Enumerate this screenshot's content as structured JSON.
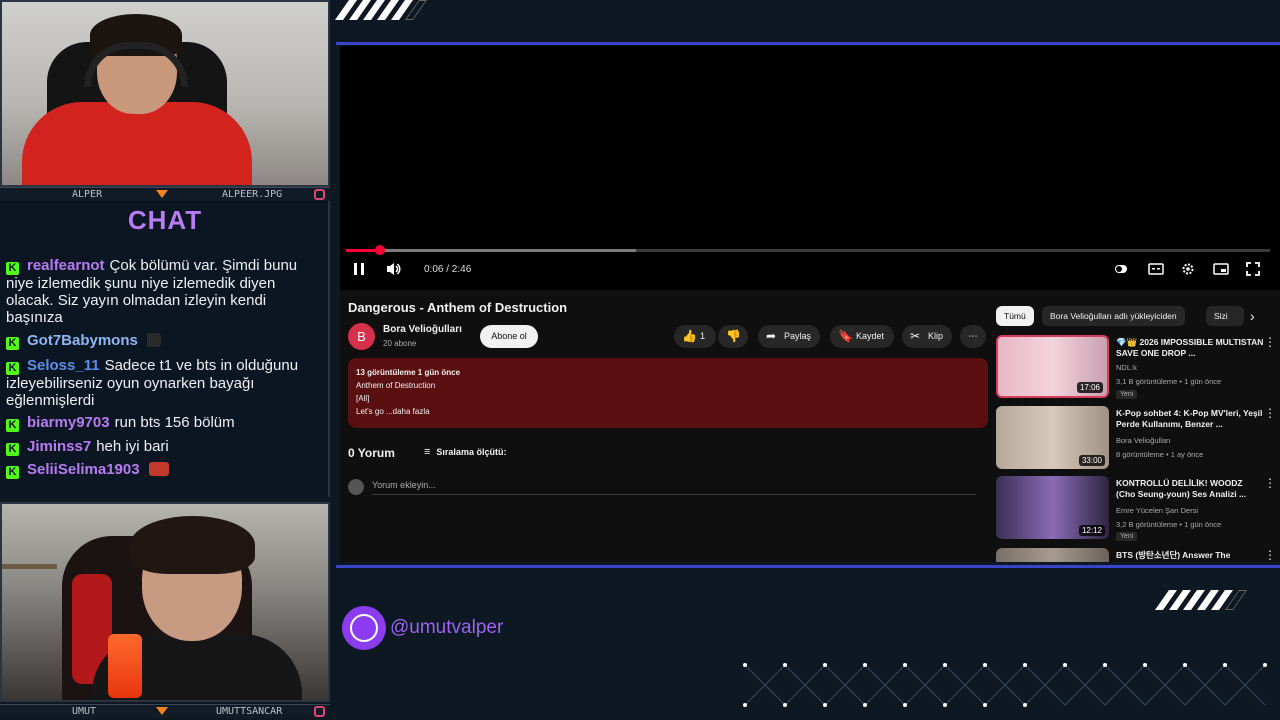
{
  "cams": {
    "top": {
      "left_name": "ALPER",
      "right_name": "ALPEER.JPG"
    },
    "bottom": {
      "left_name": "UMUT",
      "right_name": "UMUTTSANCAR"
    }
  },
  "chat": {
    "title": "CHAT",
    "messages": [
      {
        "user": "realfearnot",
        "color": "#b77cf2",
        "text": "Çok bölümü var. Şimdi bunu niye izlemedik şunu niye izlemedik diyen olacak. Siz yayın olmadan izleyin kendi başınıza"
      },
      {
        "user": "Got7Babymons",
        "color": "#8db6f2",
        "text": ""
      },
      {
        "user": "Seloss_11",
        "color": "#5b8ee8",
        "text": "Sadece t1 ve bts in olduğunu izleyebilirseniz oyun oynarken bayağı eğlenmişlerdi"
      },
      {
        "user": "biarmy9703",
        "color": "#b77cf2",
        "text": "run bts 156 bölüm"
      },
      {
        "user": "Jiminss7",
        "color": "#b77cf2",
        "text": "heh iyi bari"
      },
      {
        "user": "SeliiSelima1903",
        "color": "#b77cf2",
        "text": ""
      }
    ]
  },
  "player": {
    "time": "0:06 / 2:46",
    "progress_fraction": 0.037,
    "buffer_fraction": 0.314
  },
  "video": {
    "title": "Dangerous - Anthem of Destruction",
    "channel": "Bora Velioğulları",
    "subs": "20 abone",
    "subscribe": "Abone ol",
    "likes": "1",
    "share": "Paylaş",
    "save": "Kaydet",
    "clip": "Klip",
    "desc": {
      "stats": "13 görüntüleme  1 gün önce",
      "line1": "Anthem of Destruction",
      "line2": "[All]",
      "line3": "Let's go ...daha fazla"
    },
    "comments": "0 Yorum",
    "sort": "Sıralama ölçütü:",
    "comment_placeholder": "Yorum ekleyin..."
  },
  "chips": [
    "Tümü",
    "Bora Velioğulları adlı yükleyiciden",
    "Sizi"
  ],
  "recs": [
    {
      "title": "💎👑 2026 IMPOSSIBLE MULTISTAN SAVE ONE DROP ...",
      "channel": "NDL:k",
      "meta": "3,1 B görüntüleme • 1 gün önce",
      "badge": "Yeni",
      "duration": "17:06"
    },
    {
      "title": "K-Pop sohbet 4: K-Pop MV'leri, Yeşil Perde Kullanımı, Benzer ...",
      "channel": "Bora Velioğulları",
      "meta": "8 görüntüleme • 1 ay önce",
      "badge": "",
      "duration": "33:00"
    },
    {
      "title": "KONTROLLÜ DELİLİK! WOODZ (Cho Seung-youn) Ses Analizi ...",
      "channel": "Emre Yücelen Şan Dersi",
      "meta": "3,2 B görüntüleme • 1 gün önce",
      "badge": "Yeni",
      "duration": "12:12"
    },
    {
      "title": "BTS (방탄소년단) Answer The",
      "channel": "",
      "meta": "",
      "badge": "",
      "duration": ""
    }
  ],
  "social": {
    "handle": "@umutvalper"
  }
}
